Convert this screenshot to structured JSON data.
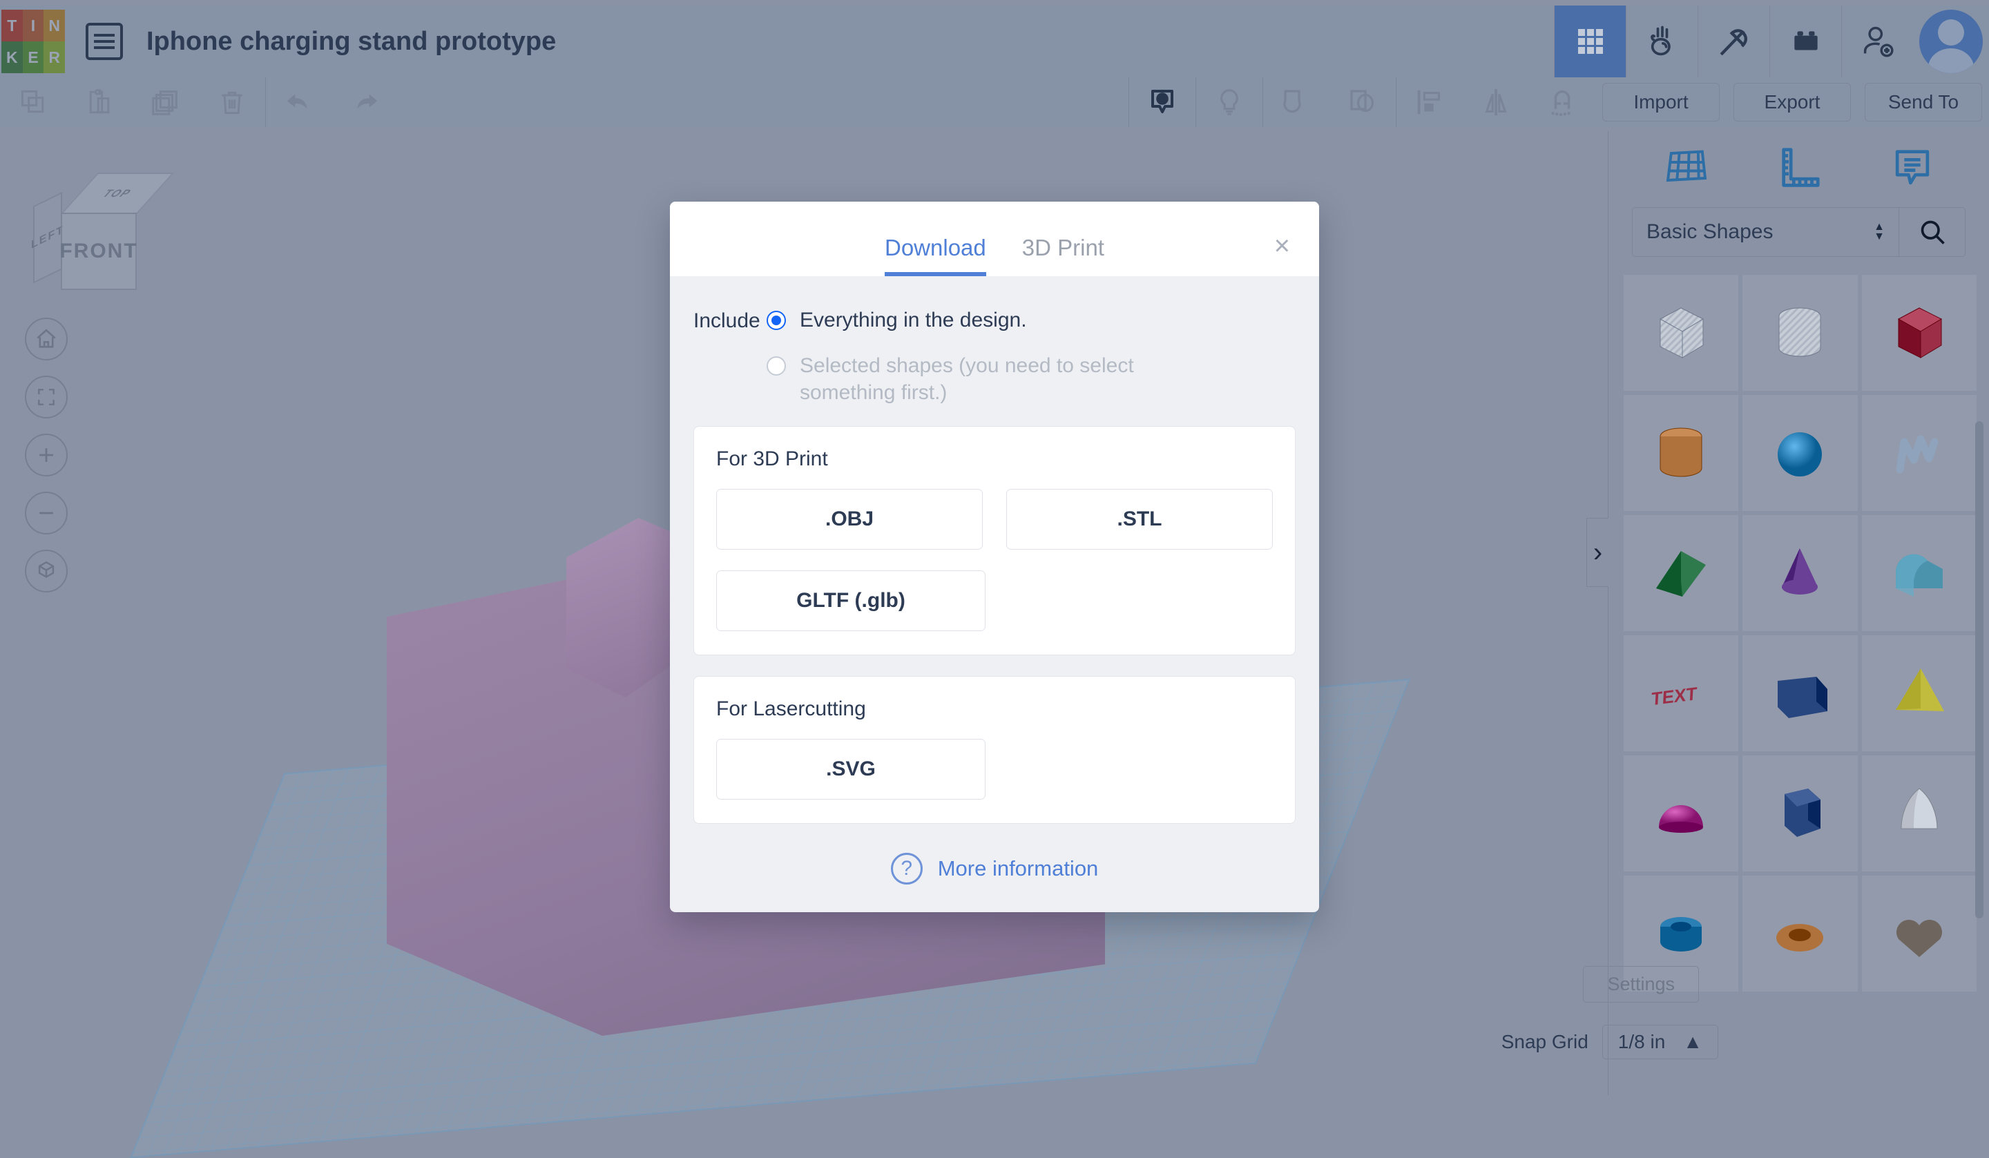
{
  "app": {
    "logo_letters": [
      "T",
      "I",
      "N",
      "K",
      "E",
      "R"
    ],
    "logo_colors": [
      "#8a4444",
      "#8a5747",
      "#8f7242",
      "#3f6a4b",
      "#4e7a46",
      "#6e8a44"
    ],
    "document_title": "Iphone charging stand prototype",
    "menu_icon": "hamburger-list-icon"
  },
  "topbar": {
    "mode_buttons": [
      {
        "name": "3d-designs-grid",
        "icon": "grid-icon",
        "active": true
      },
      {
        "name": "circuits",
        "icon": "circuits-hand-icon",
        "active": false
      },
      {
        "name": "minecraft",
        "icon": "pickaxe-icon",
        "active": false
      },
      {
        "name": "blocks",
        "icon": "lego-brick-icon",
        "active": false
      },
      {
        "name": "invite-people",
        "icon": "add-person-icon",
        "active": false
      }
    ],
    "avatar": "user-avatar"
  },
  "toolbar": {
    "left_tools": [
      {
        "name": "copy",
        "icon": "copy-icon"
      },
      {
        "name": "paste",
        "icon": "paste-clipboard-icon"
      },
      {
        "name": "duplicate",
        "icon": "duplicate-icon"
      },
      {
        "name": "delete",
        "icon": "trash-icon"
      },
      {
        "name": "undo",
        "icon": "undo-arrow-icon"
      },
      {
        "name": "redo",
        "icon": "redo-arrow-icon"
      }
    ],
    "right_tools": [
      {
        "name": "notes",
        "icon": "note-marker-icon",
        "active": true
      },
      {
        "name": "lights",
        "icon": "lightbulb-icon"
      },
      {
        "name": "group",
        "icon": "group-shapes-icon"
      },
      {
        "name": "ungroup",
        "icon": "ungroup-shapes-icon"
      },
      {
        "name": "align",
        "icon": "align-icon"
      },
      {
        "name": "mirror",
        "icon": "mirror-icon"
      },
      {
        "name": "snap-magnet",
        "icon": "magnet-icon"
      }
    ],
    "panel_buttons": [
      {
        "label": "Import",
        "name": "import-button"
      },
      {
        "label": "Export",
        "name": "export-button"
      },
      {
        "label": "Send To",
        "name": "send-to-button"
      }
    ]
  },
  "viewcube": {
    "front": "FRONT",
    "left": "LEFT",
    "top": "TOP"
  },
  "view_controls": [
    {
      "name": "home-view",
      "icon": "home-icon"
    },
    {
      "name": "fit-to-view",
      "icon": "fit-frame-icon"
    },
    {
      "name": "zoom-in",
      "icon": "plus-icon"
    },
    {
      "name": "zoom-out",
      "icon": "minus-icon"
    },
    {
      "name": "ortho-perspective-toggle",
      "icon": "cube-arrow-icon"
    }
  ],
  "right_panel": {
    "tool_icons": [
      {
        "name": "workplane",
        "icon": "workplane-grid-icon"
      },
      {
        "name": "ruler",
        "icon": "ruler-icon"
      },
      {
        "name": "note",
        "icon": "note-bubble-icon"
      }
    ],
    "library_selected": "Basic Shapes",
    "search_icon": "search-icon",
    "collapse_icon": "chevron-right-icon",
    "shapes": [
      {
        "name": "box-hole",
        "color": "#c2c8d2",
        "kind": "box",
        "hole": true
      },
      {
        "name": "cylinder-hole",
        "color": "#c2c8d2",
        "kind": "cylinder",
        "hole": true
      },
      {
        "name": "box",
        "color": "#9c2f47",
        "kind": "box",
        "hole": false
      },
      {
        "name": "cylinder",
        "color": "#b0723c",
        "kind": "cylinder",
        "hole": false
      },
      {
        "name": "sphere",
        "color": "#2a7fb5",
        "kind": "sphere",
        "hole": false
      },
      {
        "name": "scribble",
        "color": "#8fa3bd",
        "kind": "scribble",
        "hole": false
      },
      {
        "name": "roof",
        "color": "#2f7a4d",
        "kind": "wedge",
        "hole": false
      },
      {
        "name": "cone",
        "color": "#6a3f96",
        "kind": "cone",
        "hole": false
      },
      {
        "name": "round-roof",
        "color": "#4b93ad",
        "kind": "roundroof",
        "hole": false
      },
      {
        "name": "text",
        "color": "#9c2f47",
        "kind": "text",
        "label": "TEXT",
        "hole": false
      },
      {
        "name": "wedge",
        "color": "#27457f",
        "kind": "slab",
        "hole": false
      },
      {
        "name": "pyramid",
        "color": "#c2bc3e",
        "kind": "pyramid",
        "hole": false
      },
      {
        "name": "half-sphere",
        "color": "#a8348f",
        "kind": "halfsphere",
        "hole": false
      },
      {
        "name": "polygon-prism",
        "color": "#27457f",
        "kind": "prism",
        "hole": false
      },
      {
        "name": "paraboloid",
        "color": "#b6bcc6",
        "kind": "paraboloid",
        "hole": false
      },
      {
        "name": "tube",
        "color": "#2a7fb5",
        "kind": "tube",
        "hole": false
      },
      {
        "name": "torus",
        "color": "#b0723c",
        "kind": "torus",
        "hole": false
      },
      {
        "name": "heart",
        "color": "#6f655f",
        "kind": "heart",
        "hole": false
      }
    ]
  },
  "status_bar": {
    "settings_label": "Settings",
    "snap_grid_label": "Snap Grid",
    "snap_grid_value": "1/8 in",
    "snap_grid_caret": "caret-up-icon"
  },
  "modal": {
    "tabs": [
      {
        "label": "Download",
        "name": "tab-download",
        "active": true
      },
      {
        "label": "3D Print",
        "name": "tab-3d-print",
        "active": false
      }
    ],
    "close_glyph": "×",
    "include_label": "Include",
    "options": [
      {
        "text": "Everything in the design.",
        "checked": true,
        "disabled": false
      },
      {
        "text": "Selected shapes (you need to select something first.)",
        "checked": false,
        "disabled": true
      }
    ],
    "sections": [
      {
        "title": "For 3D Print",
        "buttons": [
          ".OBJ",
          ".STL",
          "GLTF (.glb)"
        ]
      },
      {
        "title": "For Lasercutting",
        "buttons": [
          ".SVG"
        ]
      }
    ],
    "more_info": {
      "glyph": "?",
      "label": "More information"
    }
  },
  "colors": {
    "app_chrome": "#8692a6",
    "canvas": "#8a93a5",
    "accent_blue": "#4f7fd6",
    "radio_blue": "#1464f6",
    "active_mode": "#4a6ea8",
    "text_dark": "#2d3b54"
  }
}
